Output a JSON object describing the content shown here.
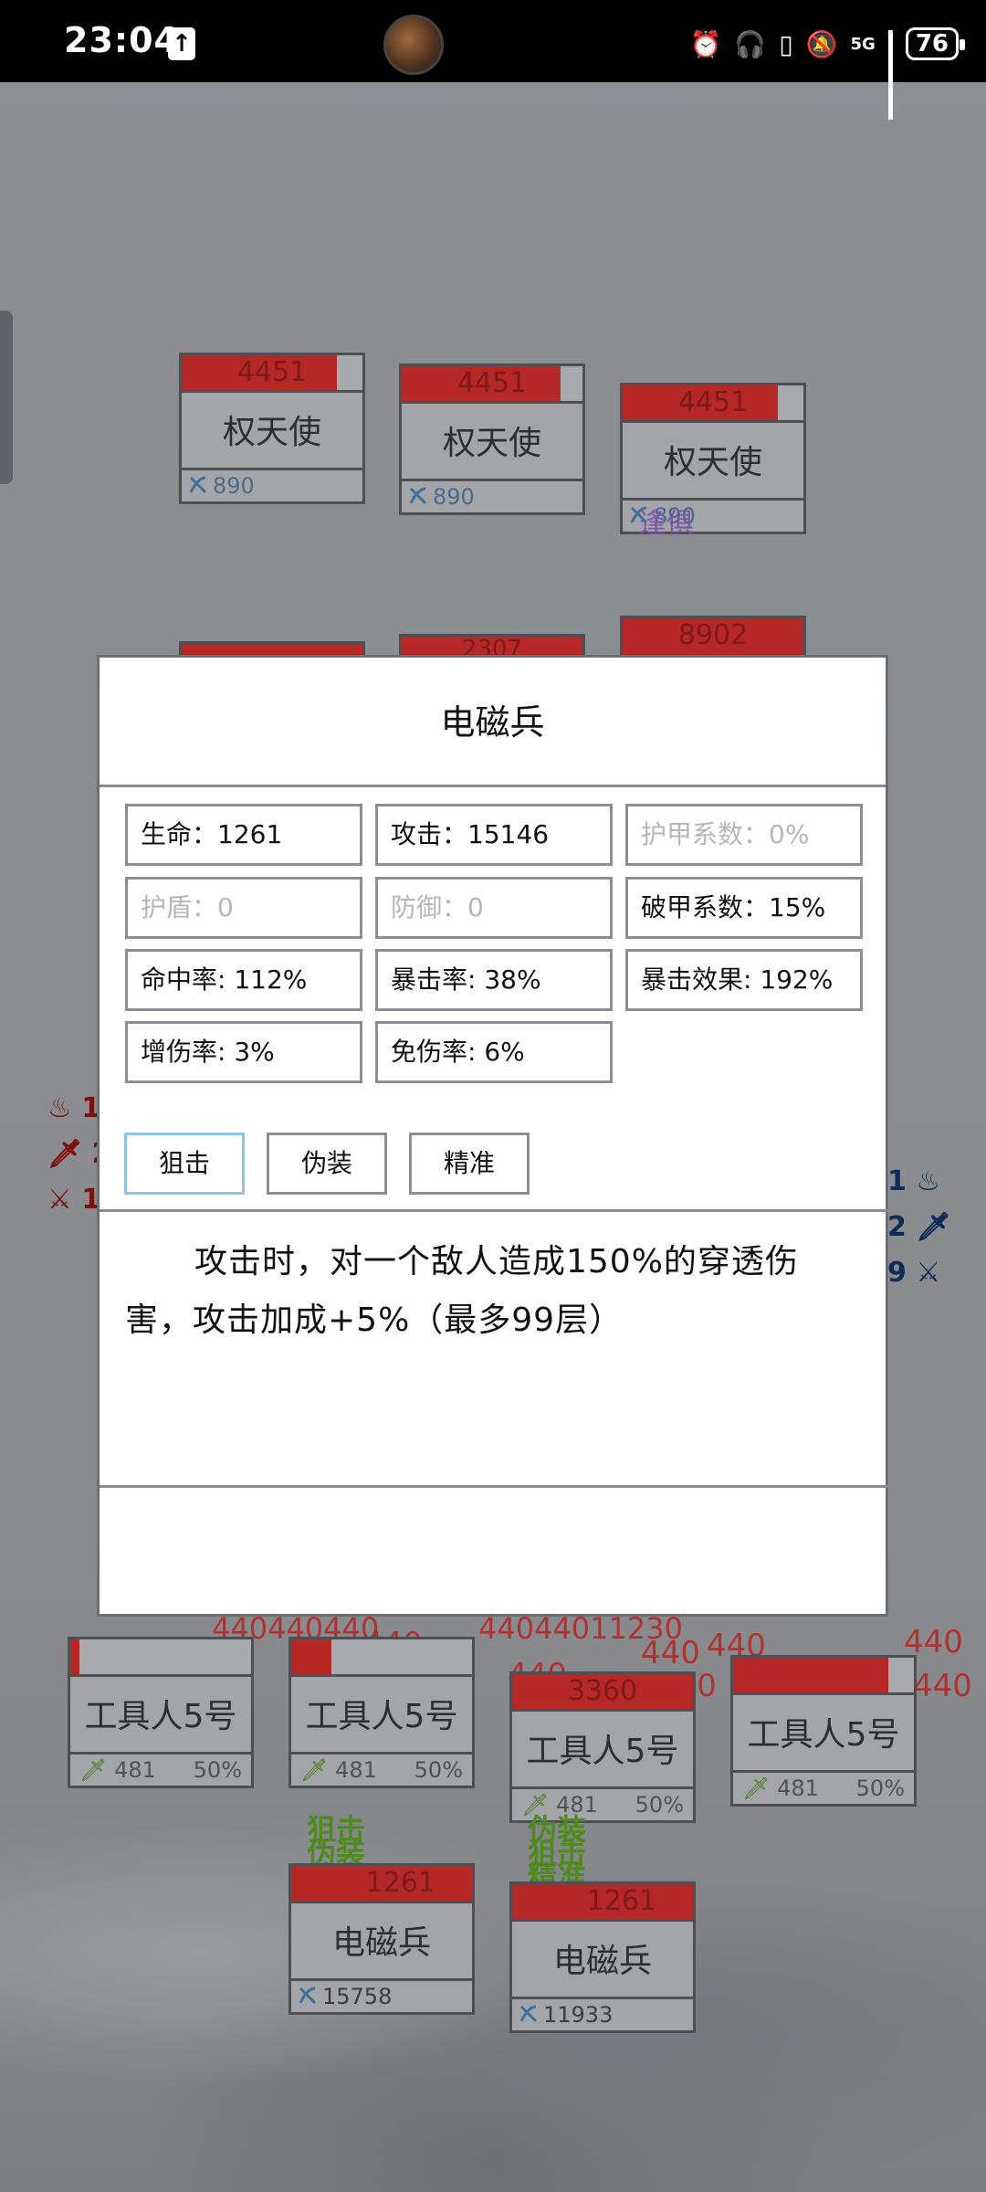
{
  "status_bar": {
    "time": "23:04",
    "network": "5G",
    "battery": "76"
  },
  "enemy_units_top": [
    {
      "hp": "4451",
      "name": "权天使",
      "attack": "890"
    },
    {
      "hp": "4451",
      "name": "权天使",
      "attack": "890"
    },
    {
      "hp": "4451",
      "name": "权天使",
      "attack": "890"
    }
  ],
  "top_status_text": "逢俱",
  "hidden_enemy_hp": [
    "2307",
    "8902"
  ],
  "left_side_stats": [
    "1",
    "2",
    "1"
  ],
  "right_side_stats": [
    "1",
    "2",
    "9"
  ],
  "modal": {
    "title": "电磁兵",
    "stats": [
      {
        "label": "生命：1261",
        "active": true
      },
      {
        "label": "攻击：15146",
        "active": true
      },
      {
        "label": "护甲系数：0%",
        "active": false
      },
      {
        "label": "护盾：0",
        "active": false
      },
      {
        "label": "防御：0",
        "active": false
      },
      {
        "label": "破甲系数：15%",
        "active": true
      },
      {
        "label": "命中率: 112%",
        "active": true
      },
      {
        "label": "暴击率: 38%",
        "active": true
      },
      {
        "label": "暴击效果: 192%",
        "active": true
      },
      {
        "label": "增伤率: 3%",
        "active": true
      },
      {
        "label": "免伤率: 6%",
        "active": true
      }
    ],
    "skills": [
      {
        "label": "狙击",
        "selected": true
      },
      {
        "label": "伪装",
        "selected": false
      },
      {
        "label": "精准",
        "selected": false
      }
    ],
    "description": "攻击时，对一个敌人造成150%的穿透伤害，攻击加成+5%（最多99层）"
  },
  "mid_units": [
    {
      "hp": "",
      "name": "工具人5号",
      "attack": "481",
      "pct": "50%"
    },
    {
      "hp": "",
      "name": "工具人5号",
      "attack": "481",
      "pct": "50%"
    },
    {
      "hp": "3360",
      "name": "工具人5号",
      "attack": "481",
      "pct": "50%"
    },
    {
      "hp": "",
      "name": "工具人5号",
      "attack": "481",
      "pct": "50%"
    }
  ],
  "damage_numbers": [
    "440",
    "440",
    "440",
    "440",
    "440",
    "440",
    "440",
    "440",
    "440",
    "440"
  ],
  "player_units": [
    {
      "hp": "1261",
      "name": "电磁兵",
      "attack": "15758",
      "buffs": "狙击 伪装 精准"
    },
    {
      "hp": "1261",
      "name": "电磁兵",
      "attack": "11933",
      "buffs": "伪装 狙击 精准"
    }
  ],
  "colors": {
    "hp_red": "#b52826",
    "overlay_bg": "#8b8d90",
    "modal_bg": "#ffffff",
    "selected_border": "#8ec3ea"
  }
}
